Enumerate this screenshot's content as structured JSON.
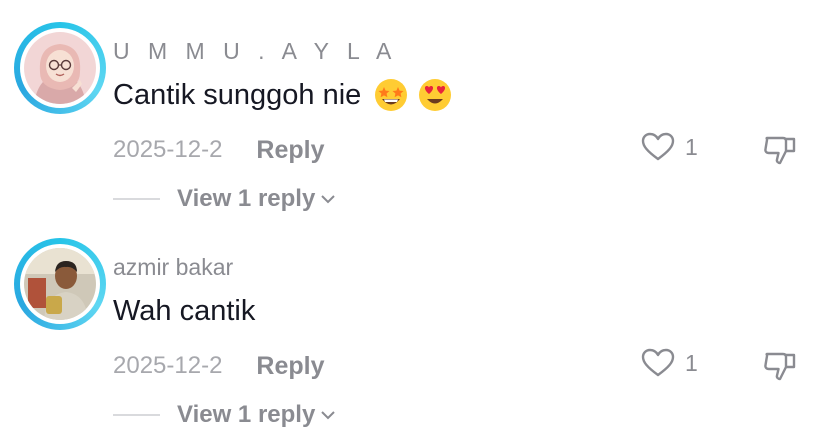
{
  "comments": [
    {
      "username": "U M M U . A Y L A",
      "text": "Cantik sunggoh nie",
      "emojis": [
        "star-struck-emoji",
        "heart-eyes-emoji"
      ],
      "date": "2025-12-2",
      "reply_label": "Reply",
      "like_count": "1",
      "view_replies_label": "View 1 reply"
    },
    {
      "username": "azmir bakar",
      "text": "Wah cantik",
      "emojis": [],
      "date": "2025-12-2",
      "reply_label": "Reply",
      "like_count": "1",
      "view_replies_label": "View 1 reply"
    }
  ],
  "icons": {
    "like": "heart-outline-icon",
    "dislike": "thumbs-down-icon",
    "expand": "chevron-down-icon"
  },
  "colors": {
    "avatar_ring": "#27c4e8",
    "primary_text": "#161823",
    "secondary_text": "#8a8b91",
    "date_text": "#a7a8ad"
  }
}
